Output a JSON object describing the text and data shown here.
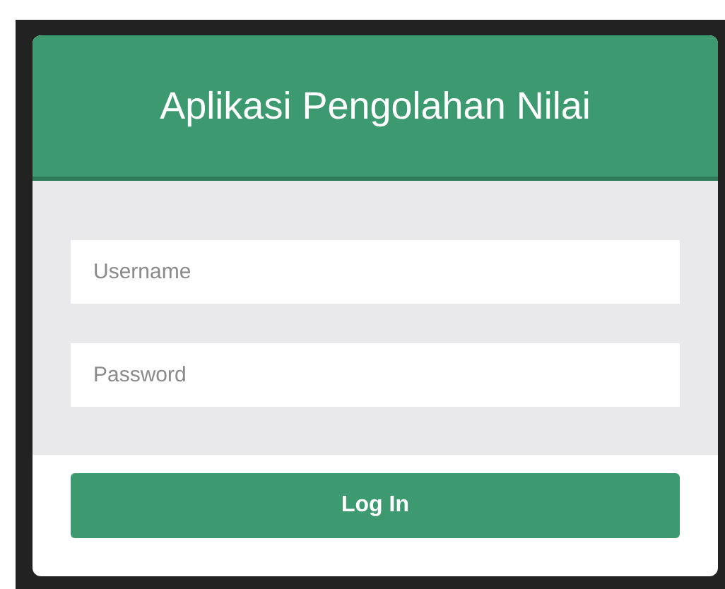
{
  "title": "Aplikasi Pengolahan Nilai",
  "fields": [
    {
      "placeholder": "Username"
    },
    {
      "placeholder": "Password"
    }
  ],
  "button": "Log In"
}
